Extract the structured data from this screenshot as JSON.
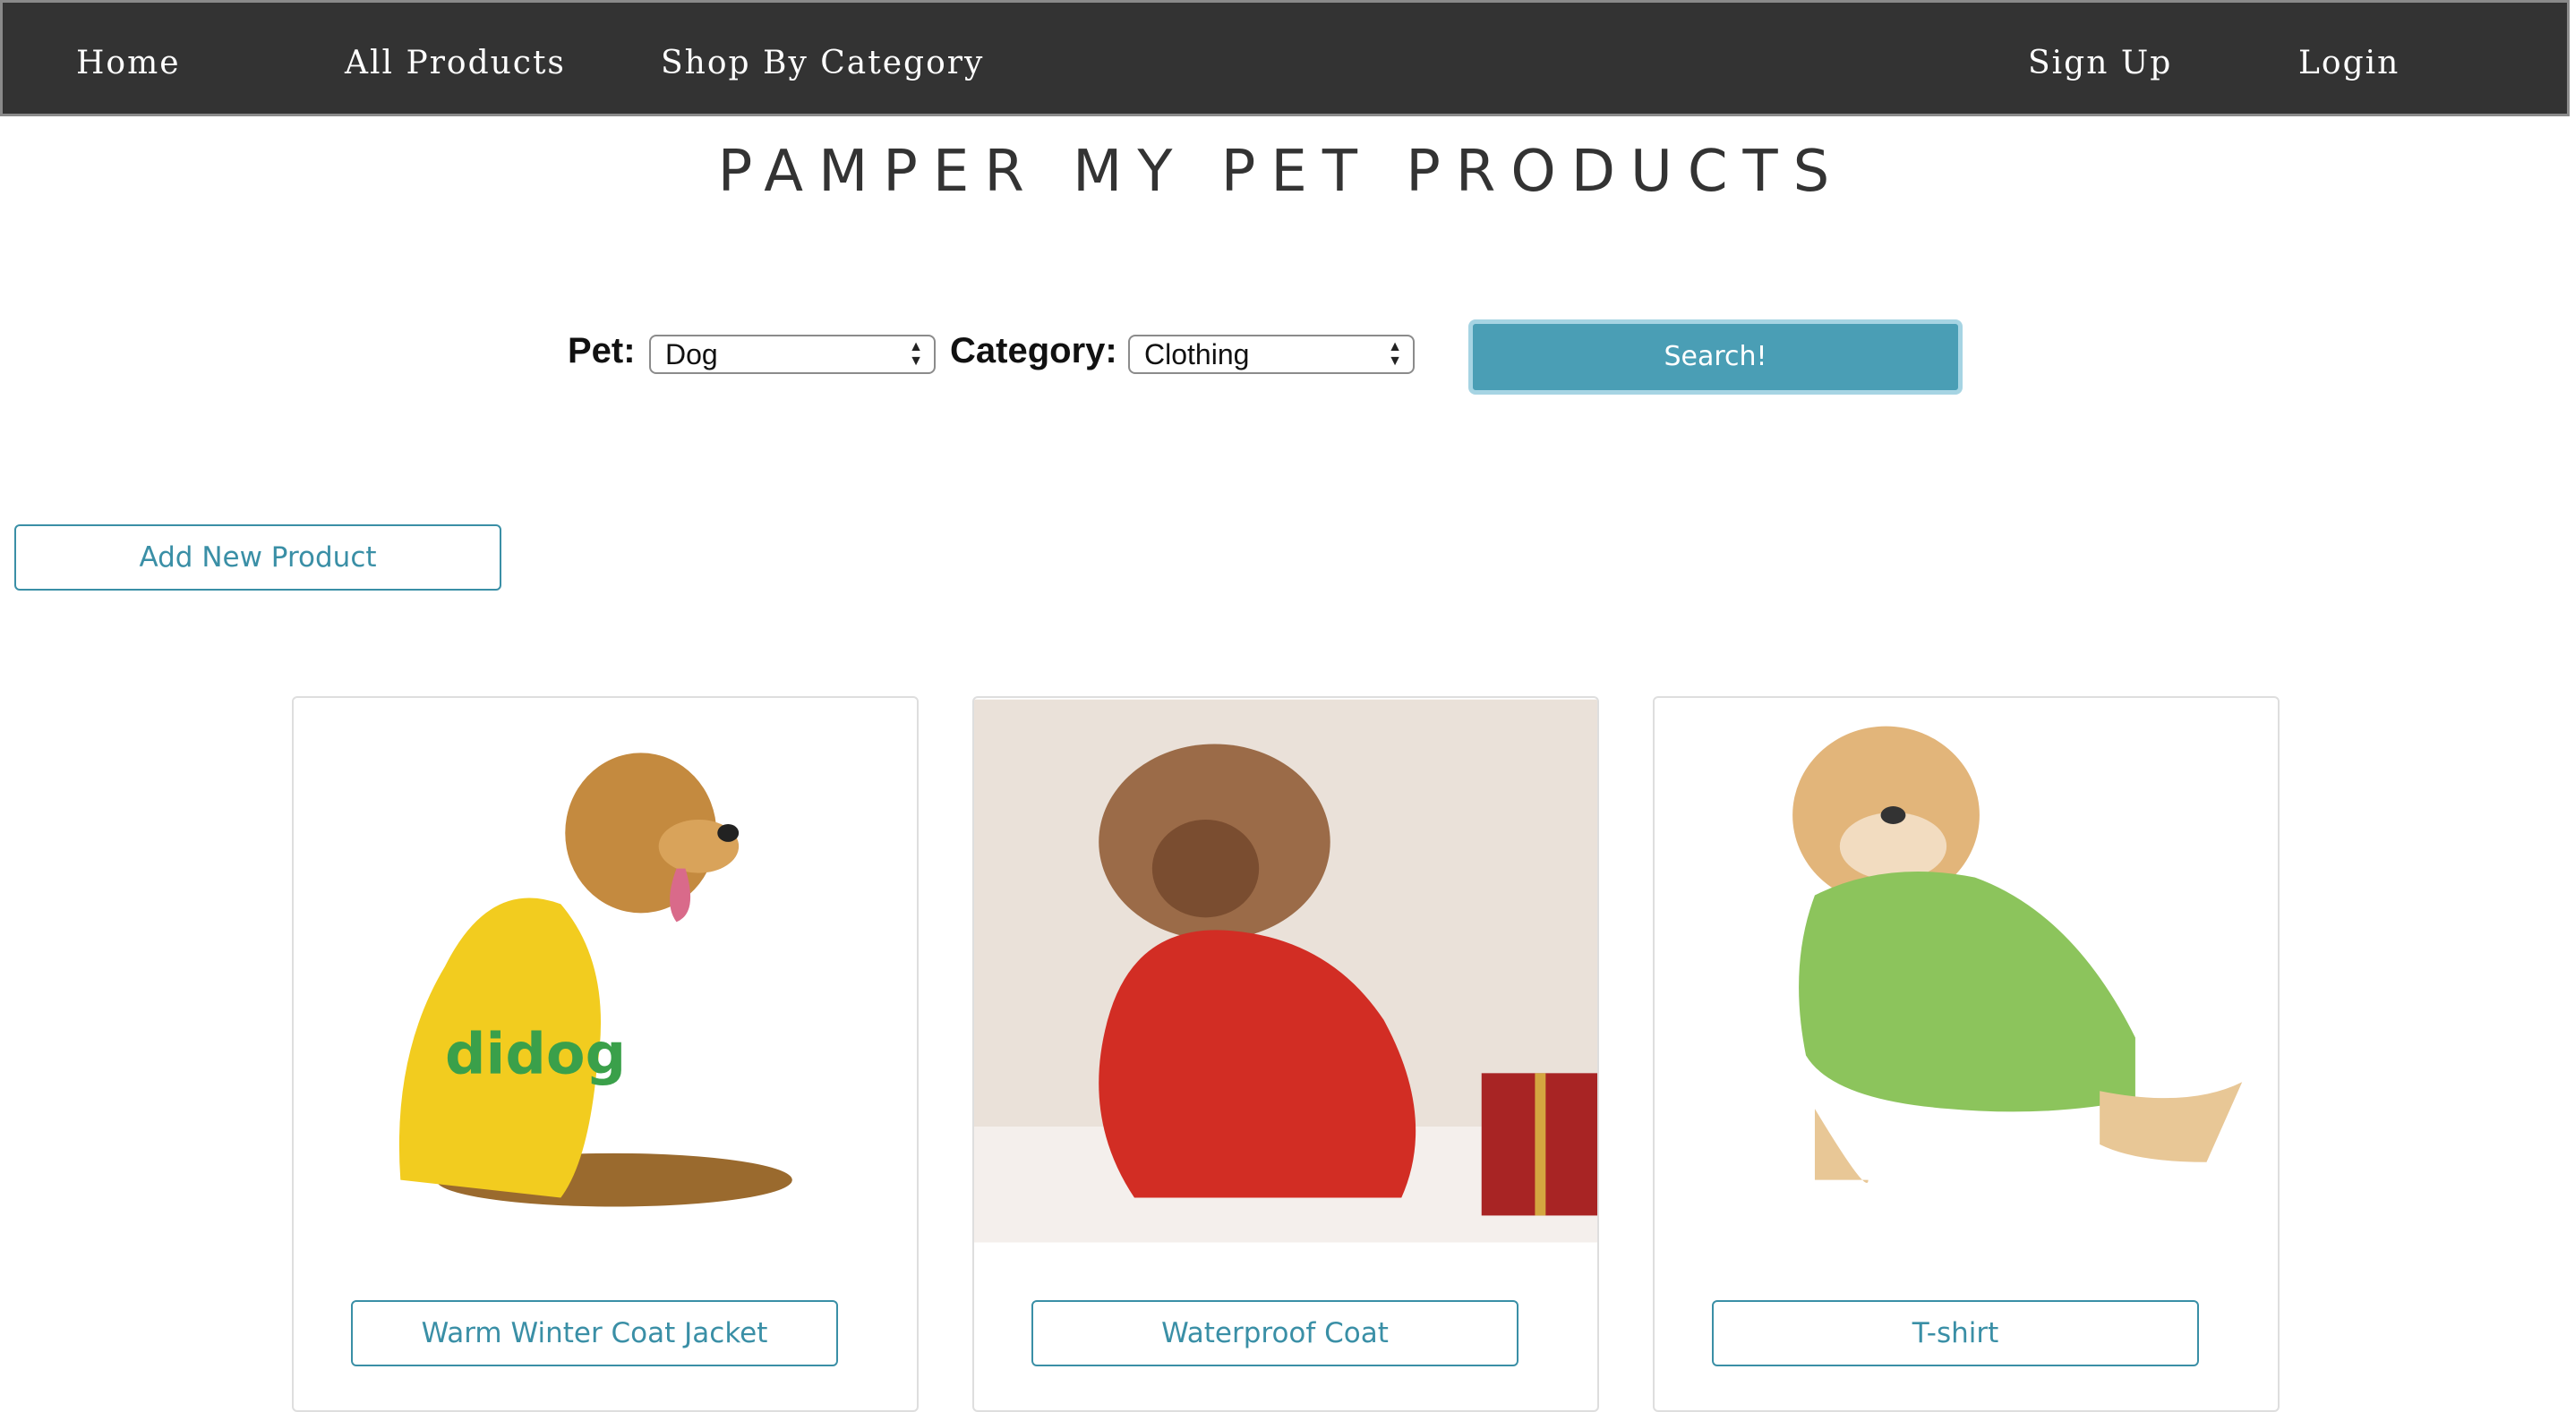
{
  "nav": {
    "home": "Home",
    "all_products": "All Products",
    "shop_by_category": "Shop By Category",
    "sign_up": "Sign Up",
    "login": "Login"
  },
  "page_title": "PAMPER MY PET PRODUCTS",
  "filters": {
    "pet_label": "Pet:",
    "pet_value": "Dog",
    "category_label": "Category:",
    "category_value": "Clothing",
    "search_button": "Search!"
  },
  "add_product_button": "Add New Product",
  "products": [
    {
      "name": "Warm Winter Coat Jacket",
      "image": "golden-dog-yellow-hoodie"
    },
    {
      "name": "Waterproof Coat",
      "image": "poodle-red-puffer-coat"
    },
    {
      "name": "T-shirt",
      "image": "golden-dog-green-tshirt"
    }
  ],
  "colors": {
    "nav_bg": "#333333",
    "accent": "#4a9eb5",
    "outline": "#3a8fa6"
  }
}
